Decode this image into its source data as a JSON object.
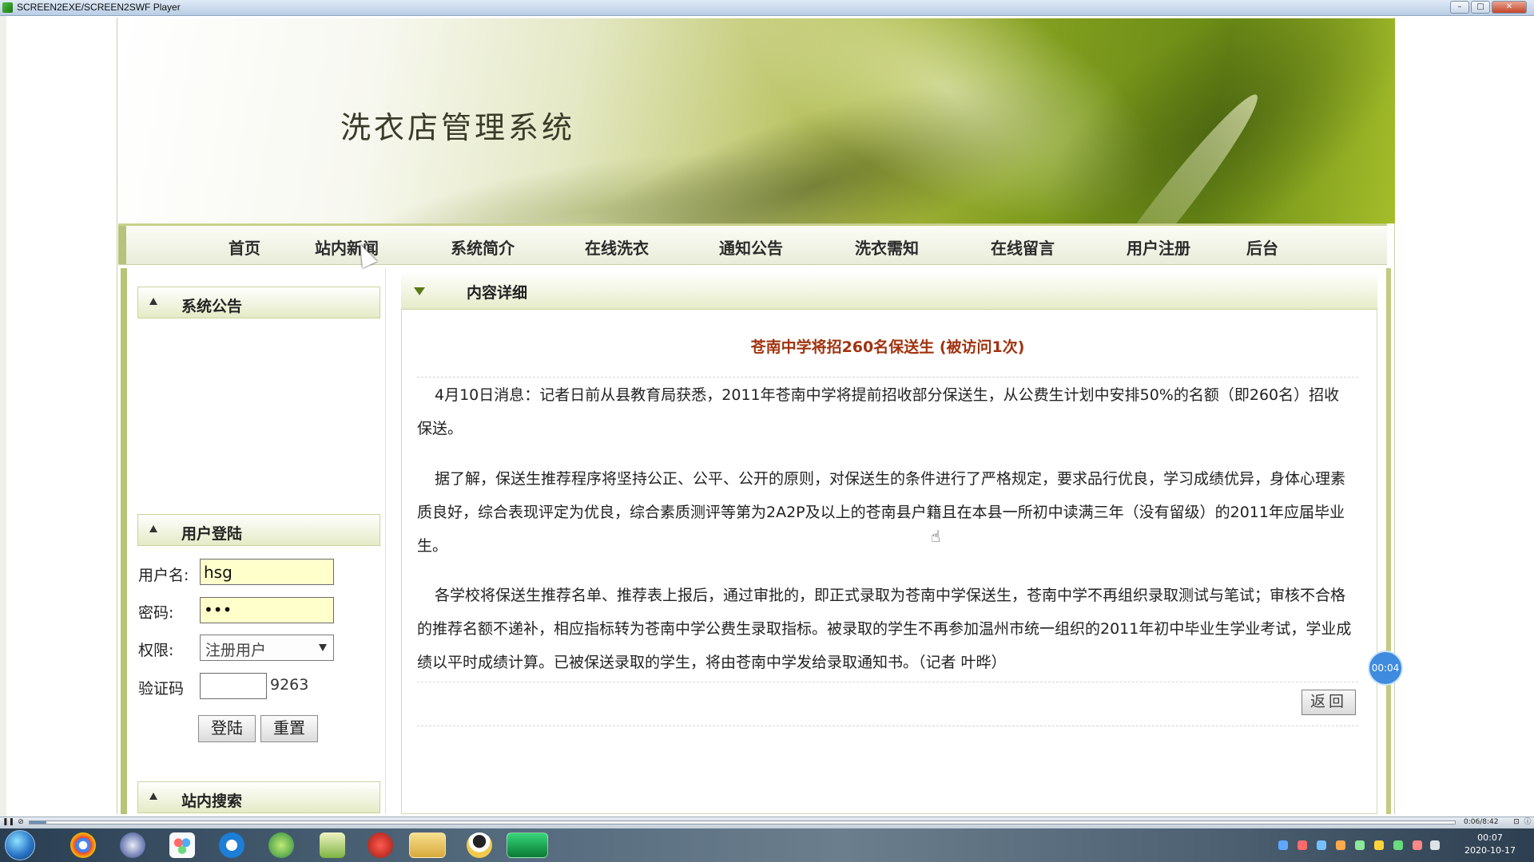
{
  "window": {
    "title": "SCREEN2EXE/SCREEN2SWF Player"
  },
  "site": {
    "title": "洗衣店管理系统"
  },
  "nav": {
    "items": [
      {
        "label": "首页"
      },
      {
        "label": "站内新闻"
      },
      {
        "label": "系统简介"
      },
      {
        "label": "在线洗衣"
      },
      {
        "label": "通知公告"
      },
      {
        "label": "洗衣需知"
      },
      {
        "label": "在线留言"
      },
      {
        "label": "用户注册"
      },
      {
        "label": "后台"
      }
    ]
  },
  "sidebar": {
    "announcement_header": "系统公告",
    "login_header": "用户登陆",
    "search_header": "站内搜索",
    "login": {
      "username_label": "用户名:",
      "username_value": "hsg",
      "password_label": "密码:",
      "password_value": "•••",
      "role_label": "权限:",
      "role_value": "注册用户",
      "captcha_label": "验证码",
      "captcha_value": "",
      "captcha_code": "9263",
      "login_button": "登陆",
      "reset_button": "重置"
    }
  },
  "content": {
    "header": "内容详细",
    "article_title": "苍南中学将招260名保送生 (被访问1次)",
    "paragraphs": [
      "4月10日消息：记者日前从县教育局获悉，2011年苍南中学将提前招收部分保送生，从公费生计划中安排50%的名额（即260名）招收保送。",
      "据了解，保送生推荐程序将坚持公正、公平、公开的原则，对保送生的条件进行了严格规定，要求品行优良，学习成绩优异，身体心理素质良好，综合表现评定为优良，综合素质测评等第为2A2P及以上的苍南县户籍且在本县一所初中读满三年（没有留级）的2011年应届毕业生。",
      "各学校将保送生推荐名单、推荐表上报后，通过审批的，即正式录取为苍南中学保送生，苍南中学不再组织录取测试与笔试；审核不合格的推荐名额不递补，相应指标转为苍南中学公费生录取指标。被录取的学生不再参加温州市统一组织的2011年初中毕业生学业考试，学业成绩以平时成绩计算。已被保送录取的学生，将由苍南中学发给录取通知书。（记者 叶晔）"
    ],
    "back_button": "返回"
  },
  "player": {
    "timer_bubble": "00:04",
    "playback_time": "0:06/8:42",
    "progress": 0.012
  },
  "taskbar": {
    "clock_time": "00:07",
    "clock_date": "2020-10-17",
    "apps": [
      "chrome-icon",
      "media-icon",
      "baidu-netdisk-icon",
      "browser-q-icon",
      "app-leaf-icon",
      "notepad-icon",
      "flash-icon",
      "explorer-icon",
      "qq-icon",
      "player-icon"
    ]
  },
  "colors": {
    "accent_green": "#b6c477",
    "title_red": "#a0330f",
    "input_yellow": "#ffffcc",
    "timer_blue": "#3e8be0"
  }
}
